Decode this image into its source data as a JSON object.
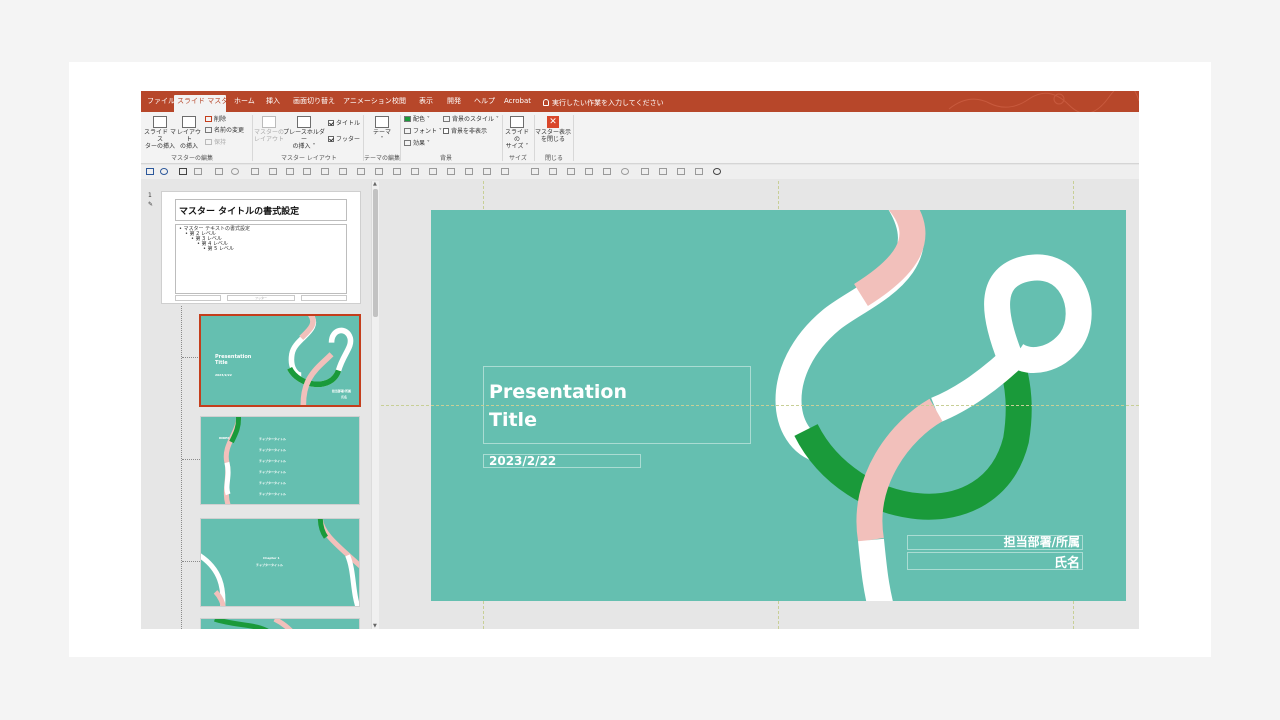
{
  "tabs": {
    "items": [
      {
        "label": "ファイル"
      },
      {
        "label": "スライド マスター"
      },
      {
        "label": "ホーム"
      },
      {
        "label": "挿入"
      },
      {
        "label": "画面切り替え"
      },
      {
        "label": "アニメーション"
      },
      {
        "label": "校閲"
      },
      {
        "label": "表示"
      },
      {
        "label": "開発"
      },
      {
        "label": "ヘルプ"
      },
      {
        "label": "Acrobat"
      }
    ],
    "tell_me": "実行したい作業を入力してください"
  },
  "ribbon": {
    "insert_master_l1": "スライド マス",
    "insert_master_l2": "ターの挿入",
    "insert_layout_l1": "レイアウト",
    "insert_layout_l2": "の挿入",
    "delete": "削除",
    "rename": "名前の変更",
    "preserve": "保持",
    "group_edit_master": "マスターの編集",
    "master_layout_l1": "マスターの",
    "master_layout_l2": "レイアウト",
    "insert_placeholder_l1": "プレースホルダー",
    "insert_placeholder_l2": "の挿入 ˅",
    "title_check": "タイトル",
    "footer_check": "フッター",
    "group_master_layout": "マスター レイアウト",
    "theme": "テーマ",
    "group_edit_theme": "テーマの編集",
    "colors": "配色 ˅",
    "fonts": "フォント ˅",
    "effects": "効果 ˅",
    "background_styles": "背景のスタイル ˅",
    "hide_background": "背景を非表示",
    "group_background": "背景",
    "slide_size_l1": "スライドの",
    "slide_size_l2": "サイズ ˅",
    "group_size": "サイズ",
    "close_master_l1": "マスター表示",
    "close_master_l2": "を閉じる",
    "group_close": "閉じる"
  },
  "thumbnails": {
    "slide_number": "1",
    "master_title": "マスター タイトルの書式設定",
    "master_body": [
      "• マスター テキストの書式設定",
      "• 第 2 レベル",
      "• 第 3 レベル",
      "• 第 4 レベル",
      "• 第 5 レベル"
    ],
    "master_footer": "フッター",
    "thumb1_title": "Presentation\nTitle",
    "thumb1_date": "2023/2/22",
    "thumb1_dept": "担当部署/所属",
    "thumb1_name": "氏名",
    "thumb2_title": "INDEX",
    "thumb2_item": "チャプタータイトル",
    "thumb3_chapter": "Chapter 1",
    "thumb3_title": "チャプタータイトル"
  },
  "slide": {
    "title_line1": "Presentation",
    "title_line2": "Title",
    "date": "2023/2/22",
    "department": "担当部署/所属",
    "name": "氏名"
  },
  "colors": {
    "ribbon_red": "#b7472a",
    "slide_teal": "#65bfb0",
    "ribbon_green": "#1a9a3a",
    "ribbon_pink": "#f2c0bb",
    "ribbon_white": "#ffffff"
  }
}
